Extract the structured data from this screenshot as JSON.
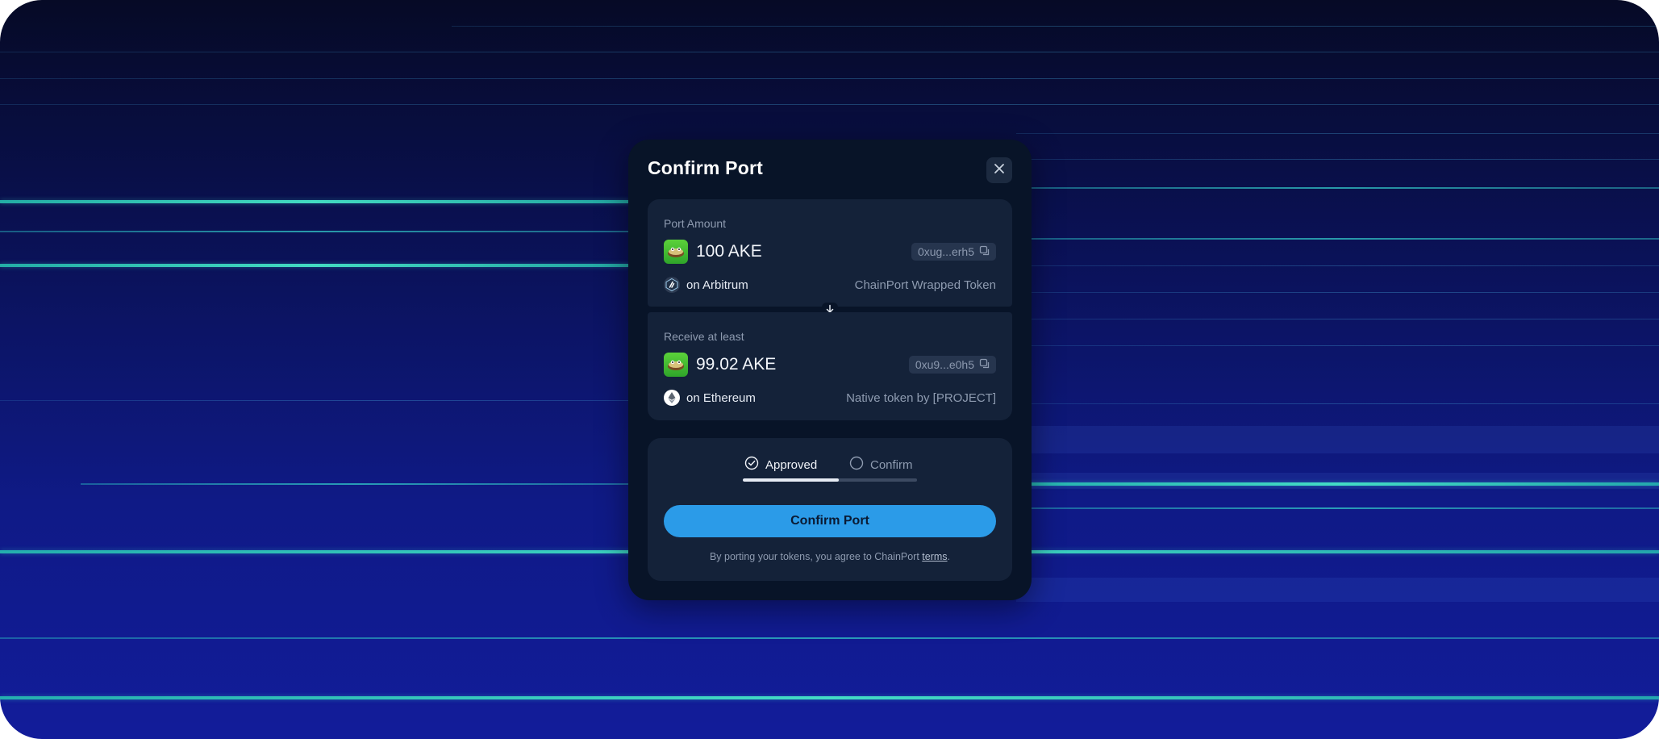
{
  "modal": {
    "title": "Confirm Port"
  },
  "source": {
    "label": "Port Amount",
    "amount": "100 AKE",
    "address": "0xug...erh5",
    "chain": "on Arbitrum",
    "token_type": "ChainPort Wrapped Token"
  },
  "destination": {
    "label": "Receive at least",
    "amount": "99.02 AKE",
    "address": "0xu9...e0h5",
    "chain": "on Ethereum",
    "token_type": "Native token by [PROJECT]"
  },
  "steps": {
    "step1": "Approved",
    "step2": "Confirm",
    "progress_fraction": 0.55
  },
  "action": {
    "button_label": "Confirm Port"
  },
  "terms": {
    "text_before": "By porting your tokens, you agree to ChainPort ",
    "link": "terms",
    "text_after": "."
  },
  "colors": {
    "primary_button": "#2b9be8",
    "modal_bg": "#081428",
    "card_bg": "#142239",
    "accent_lines": "#3fe0c4"
  },
  "icons": [
    "close-icon",
    "token-icon",
    "copy-icon",
    "arbitrum-icon",
    "arrow-down-icon",
    "ethereum-icon",
    "check-circle-icon",
    "empty-circle-icon"
  ]
}
